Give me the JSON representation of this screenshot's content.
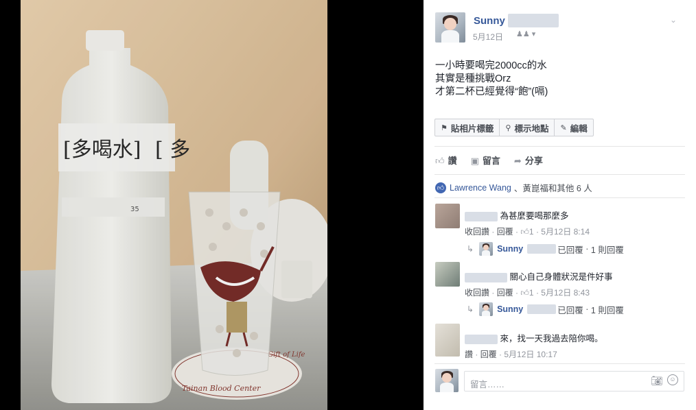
{
  "post": {
    "author": "Sunny",
    "date": "5月12日",
    "privacy_icon": "friends-icon",
    "text_lines": [
      "一小時要喝完2000cc的水",
      "其實是種挑戰Orz",
      "才第二杯已經覺得“飽”(嗝)"
    ]
  },
  "photo_actions": [
    {
      "icon": "tag-icon",
      "label": "貼相片標籤"
    },
    {
      "icon": "location-pin-icon",
      "label": "標示地點"
    },
    {
      "icon": "pencil-icon",
      "label": "編輯"
    }
  ],
  "ufi": {
    "like": "讚",
    "comment": "留言",
    "share": "分享"
  },
  "likes": {
    "name": "Lawrence Wang",
    "rest": "、黃崑福和其他 6 人"
  },
  "comments": [
    {
      "text": "為甚麼要喝那麼多",
      "withdraw": "收回讚",
      "reply": "回覆",
      "likes": "1",
      "time": "5月12日 8:14",
      "reply_preview": {
        "name": "Sunny",
        "action": "已回覆",
        "count": "1 則回覆"
      }
    },
    {
      "text": "關心自己身體狀況是件好事",
      "withdraw": "收回讚",
      "reply": "回覆",
      "likes": "1",
      "time": "5月12日 8:43",
      "reply_preview": {
        "name": "Sunny",
        "action": "已回覆",
        "count": "1 則回覆"
      }
    },
    {
      "text": "來，找一天我過去陪你喝。",
      "like": "讚",
      "reply": "回覆",
      "time": "5月12日 10:17"
    }
  ],
  "compose": {
    "placeholder": "留言……"
  },
  "photo_text": {
    "bottle_label": "[多喝水]",
    "bottle_label_2": "[ 多",
    "coaster_line_1": "Tainan Blood Center",
    "coaster_line_2": "Gift of Life",
    "bottle_number": "35"
  }
}
